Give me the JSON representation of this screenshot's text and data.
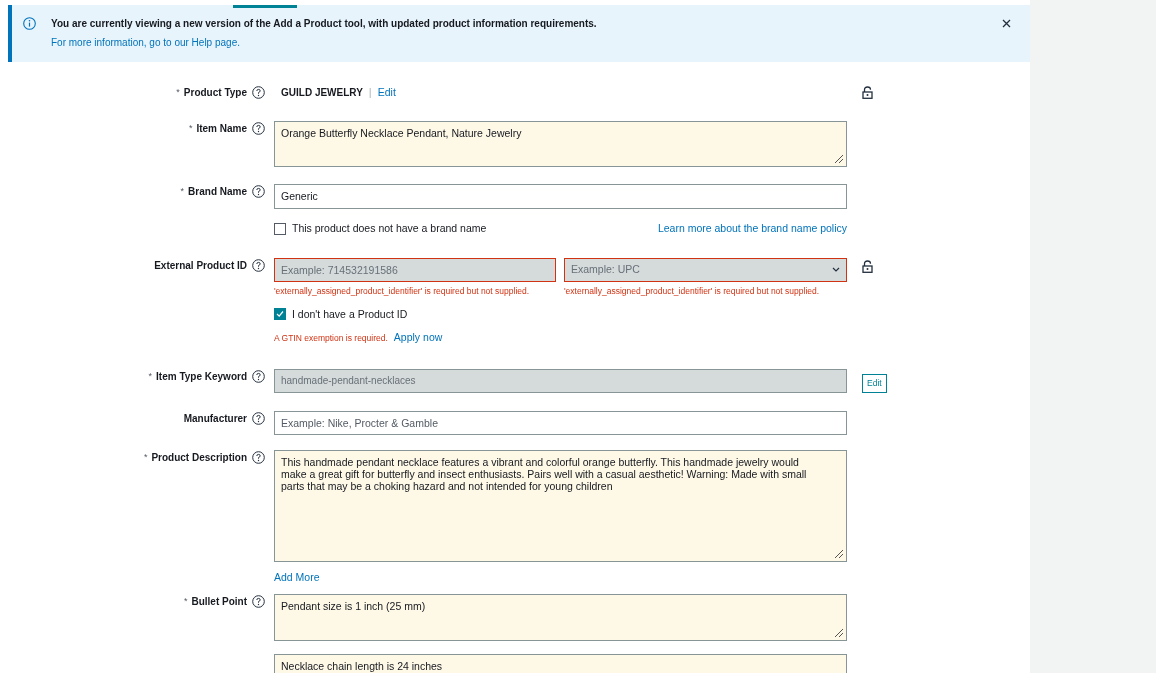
{
  "banner": {
    "title": "You are currently viewing a new version of the Add a Product tool, with updated product information requirements.",
    "text": "For more information, go to our Help page."
  },
  "product_type": {
    "required_mark": "*",
    "label": "Product Type",
    "value": "GUILD JEWELRY",
    "separator": "|",
    "edit": "Edit",
    "locked": true
  },
  "item_name": {
    "required_mark": "*",
    "label": "Item Name",
    "value": "Orange Butterfly Necklace Pendant, Nature Jewelry"
  },
  "brand_name": {
    "required_mark": "*",
    "label": "Brand Name",
    "value": "Generic",
    "no_brand": {
      "label": "This product does not have a brand name",
      "checked": false
    },
    "policy_link": "Learn more about the brand name policy"
  },
  "external_id": {
    "label": "External Product ID",
    "id_placeholder": "Example: 714532191586",
    "type_placeholder": "Example: UPC",
    "id_error": "'externally_assigned_product_identifier' is required but not supplied.",
    "type_error": "'externally_assigned_product_identifier' is required but not supplied.",
    "locked": true,
    "no_id": {
      "label": "I don't have a Product ID",
      "checked": true
    },
    "gtin_error": "A GTIN exemption is required.",
    "apply_link": "Apply now"
  },
  "item_type_keyword": {
    "required_mark": "*",
    "label": "Item Type Keyword",
    "value": "handmade-pendant-necklaces",
    "disabled": true,
    "edit": "Edit"
  },
  "manufacturer": {
    "label": "Manufacturer",
    "placeholder": "Example: Nike, Procter & Gamble"
  },
  "product_description": {
    "required_mark": "*",
    "label": "Product Description",
    "value": "This handmade pendant necklace features a vibrant and colorful orange butterfly. This handmade jewelry would make a great gift for butterfly and insect enthusiasts. Pairs well with a casual aesthetic! Warning: Made with small parts that may be a choking hazard and not intended for young children",
    "add_more": "Add More"
  },
  "bullet_point": {
    "required_mark": "*",
    "label": "Bullet Point",
    "values": [
      "Pendant size is 1 inch (25 mm)",
      "Necklace chain length is 24 inches"
    ]
  }
}
